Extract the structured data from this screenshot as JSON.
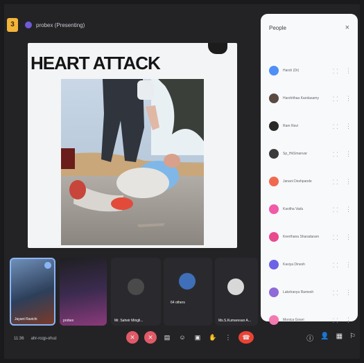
{
  "window": {
    "badge": "3",
    "presenter_label": "probex (Presenting)"
  },
  "slide": {
    "title": "HEART ATTACK"
  },
  "people_panel": {
    "title": "People",
    "close_glyph": "×",
    "participants": [
      {
        "name": "Harsh (Dr)",
        "avatar_color": "#4f8ff7"
      },
      {
        "name": "Harshithaa Kandasamy",
        "avatar_color": "#5a4a42"
      },
      {
        "name": "Ram Ravi",
        "avatar_color": "#2b2a28"
      },
      {
        "name": "Sp_HkSmanvar",
        "avatar_color": "#3b3b3b"
      },
      {
        "name": "Janani Deshpande",
        "avatar_color": "#f06a4f"
      },
      {
        "name": "Kavitha Vadu",
        "avatar_color": "#f05aa8"
      },
      {
        "name": "Keerthana Sharadaram",
        "avatar_color": "#e94a8f"
      },
      {
        "name": "Kaviya Dinesh",
        "avatar_color": "#6c63e8"
      },
      {
        "name": "Lakshanya Ramesh",
        "avatar_color": "#8f6ad8"
      },
      {
        "name": "Monica Gowri",
        "avatar_color": "#f27ab0"
      }
    ]
  },
  "tiles": [
    {
      "label": "Jayant Ravichi",
      "highlighted": true
    },
    {
      "label": "probex",
      "highlighted": false
    },
    {
      "label": "Mr. Saheir Mingli...",
      "highlighted": false
    },
    {
      "label": "64 others",
      "highlighted": false
    },
    {
      "label": "Ms.S.Kumaresan A...",
      "highlighted": false
    }
  ],
  "bottom_bar": {
    "time": "11:36",
    "meeting_code": "ahr-rcqp-ohuz"
  },
  "icons": {
    "mic_off": "mic-off-icon",
    "cam_off": "camera-off-icon",
    "captions": "captions-icon",
    "emoji": "emoji-icon",
    "present": "present-icon",
    "hand": "raise-hand-icon",
    "more": "more-icon",
    "end_call": "end-call-icon",
    "info": "info-icon",
    "people": "people-icon",
    "chat": "chat-icon",
    "activities": "activities-icon"
  },
  "colors": {
    "accent_red": "#ea4335",
    "badge_yellow": "#f3b43a",
    "panel_bg": "#f8f9fb"
  }
}
